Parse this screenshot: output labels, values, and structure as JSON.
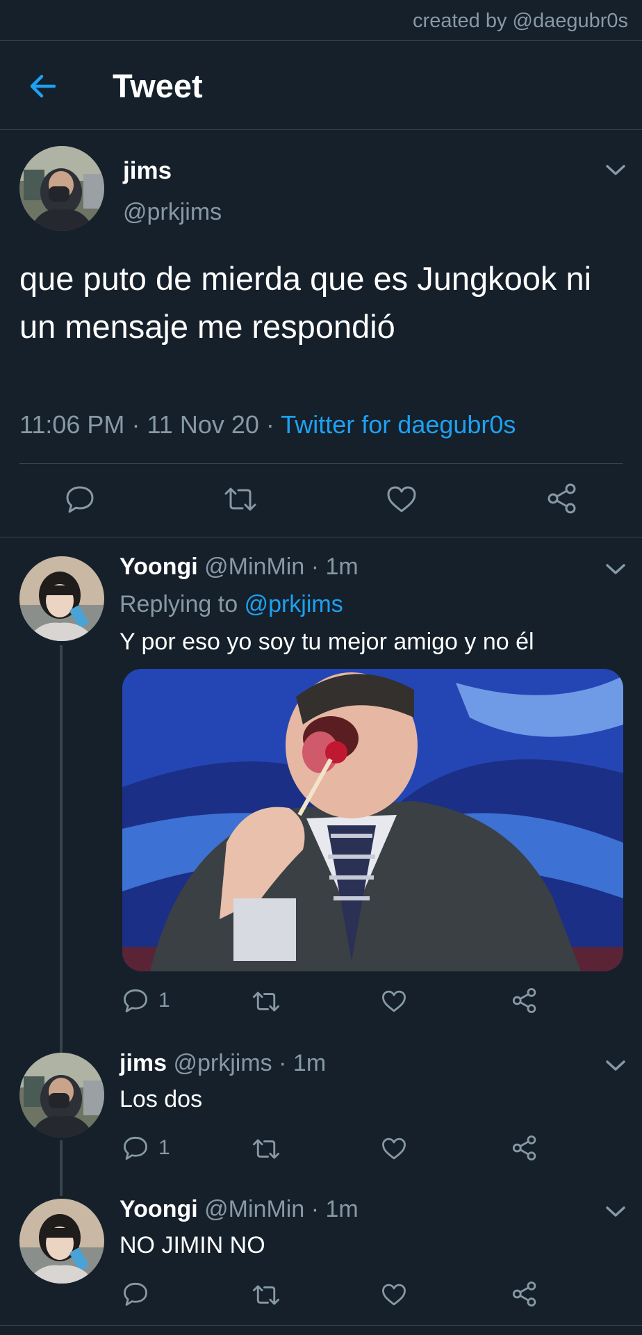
{
  "watermark": "created by @daegubr0s",
  "header": {
    "title": "Tweet"
  },
  "main_tweet": {
    "name": "jims",
    "handle": "@prkjims",
    "text": "que puto de mierda que es Jungkook ni un mensaje me respondió",
    "time": "11:06 PM",
    "date": "11 Nov 20",
    "source": "Twitter for daegubr0s"
  },
  "replies": [
    {
      "name": "Yoongi",
      "handle": "@MinMin",
      "time": "1m",
      "replying_prefix": "Replying to",
      "replying_handle": "@prkjims",
      "text": "Y por eso yo soy tu mejor amigo y no él",
      "reply_count": "1"
    },
    {
      "name": "jims",
      "handle": "@prkjims",
      "time": "1m",
      "text": "Los dos",
      "reply_count": "1"
    },
    {
      "name": "Yoongi",
      "handle": "@MinMin",
      "time": "1m",
      "text": "NO JIMIN NO",
      "reply_count": ""
    }
  ],
  "separator": "·",
  "colors": {
    "background": "#15202b",
    "accent": "#1da1f2",
    "muted": "#8899a6",
    "divider": "#38444d"
  },
  "icons": [
    "back-arrow-icon",
    "chevron-down-icon",
    "reply-icon",
    "retweet-icon",
    "like-icon",
    "share-icon"
  ]
}
